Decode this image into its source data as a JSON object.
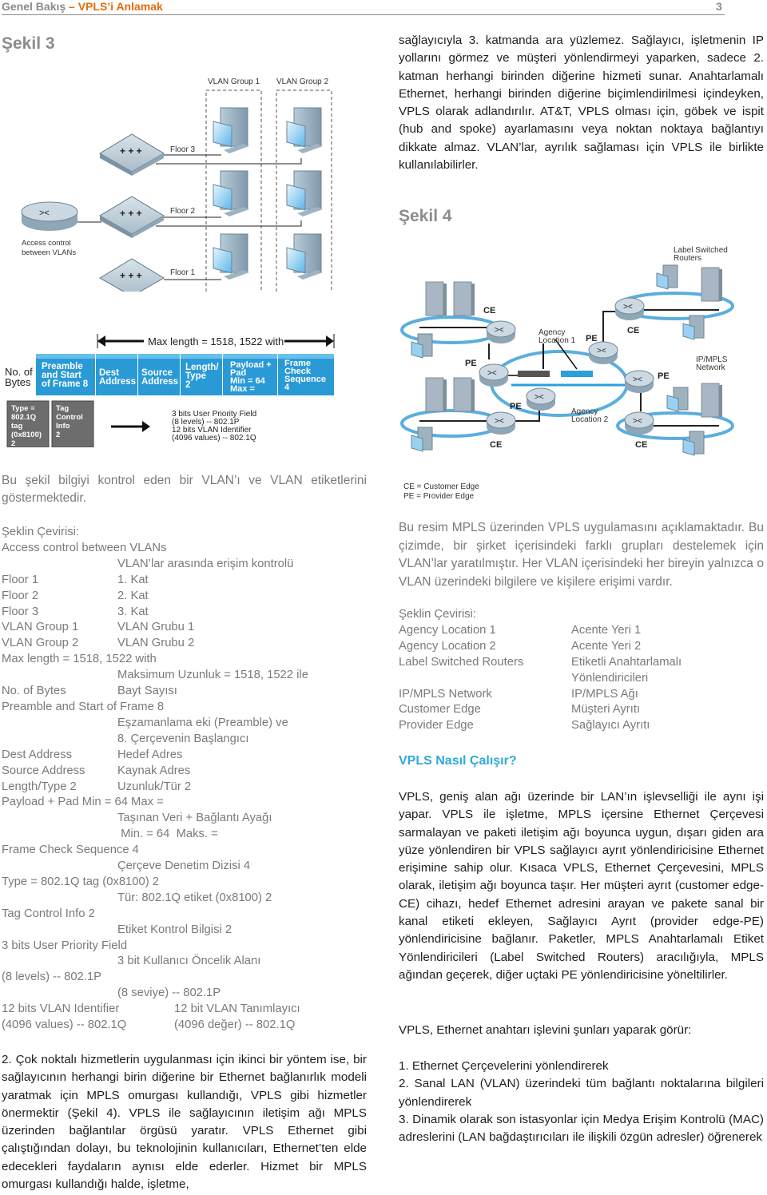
{
  "header": {
    "title_gray": "Genel Bakış ",
    "title_accent": "– VPLS’i Anlamak",
    "page_number": "3"
  },
  "colors": {
    "accent_orange": "#e36c0a",
    "section_blue": "#31a8d8",
    "frame_blue": "#2a9ad6",
    "tag_gray": "#6d6d6d"
  },
  "figure3": {
    "title": "Şekil 3",
    "vlan_groups": [
      "VLAN Group 1",
      "VLAN Group 2"
    ],
    "floors": [
      "Floor 3",
      "Floor 2",
      "Floor 1"
    ],
    "router_label_1": "Access control",
    "router_label_2": "between VLANs"
  },
  "frame_diagram": {
    "max_length": "Max length = 1518, 1522 with",
    "bytes_label_1": "No. of",
    "bytes_label_2": "Bytes",
    "cells": [
      [
        "Preamble",
        "and Start",
        "of Frame 8"
      ],
      [
        "Dest",
        "Address"
      ],
      [
        "Source",
        "Address"
      ],
      [
        "Length/",
        "Type",
        "2"
      ],
      [
        "Payload +",
        "Pad",
        "Min = 64",
        "Max ="
      ],
      [
        "Frame",
        "Check",
        "Sequence",
        "4"
      ]
    ],
    "tag_cells": [
      [
        "Type =",
        "802.1Q",
        "tag",
        "(0x8100)",
        "2"
      ],
      [
        "Tag",
        "Control",
        "Info",
        "2"
      ]
    ],
    "tag_details": [
      "3 bits User Priority Field",
      "(8 levels) -- 802.1P",
      "12 bits VLAN Identifier",
      "(4096 values) -- 802.1Q"
    ]
  },
  "figure3_caption": "Bu şekil bilgiyi kontrol eden bir VLAN’ı ve VLAN etiketlerini göstermektedir.",
  "translation_left": {
    "title": "Şeklin Çevirisi:",
    "entries": [
      {
        "en": "Access control between VLANs",
        "tr": "VLAN’lar arasında erişim kontrolü",
        "layout": "stacked"
      },
      {
        "en": "Floor 1",
        "tr": "1. Kat",
        "layout": "inline"
      },
      {
        "en": "Floor 2",
        "tr": "2. Kat",
        "layout": "inline"
      },
      {
        "en": "Floor 3",
        "tr": "3. Kat",
        "layout": "inline"
      },
      {
        "en": "VLAN Group 1",
        "tr": "VLAN Grubu 1",
        "layout": "inline"
      },
      {
        "en": "VLAN Group 2",
        "tr": "VLAN Grubu 2",
        "layout": "inline"
      },
      {
        "en": "Max length = 1518, 1522 with",
        "tr": "Maksimum Uzunluk = 1518, 1522 ile",
        "layout": "stacked"
      },
      {
        "en": "No. of Bytes",
        "tr": "Bayt Sayısı",
        "layout": "inline"
      },
      {
        "en": "Preamble and Start of Frame 8",
        "tr": "Eşzamanlama eki (Preamble) ve",
        "tr2": "8. Çerçevenin Başlangıcı",
        "layout": "stacked"
      },
      {
        "en": "Dest Address",
        "tr": "Hedef Adres",
        "layout": "inline"
      },
      {
        "en": "Source Address",
        "tr": "Kaynak Adres",
        "layout": "inline"
      },
      {
        "en": "Length/Type 2",
        "tr": "Uzunluk/Tür 2",
        "layout": "inline"
      },
      {
        "en": "Payload + Pad Min = 64 Max =",
        "tr": "Taşınan Veri + Bağlantı Ayağı",
        "tr2": " Min. = 64  Maks. =",
        "layout": "stacked"
      },
      {
        "en": "Frame Check Sequence 4",
        "tr": "Çerçeve Denetim Dizisi 4",
        "layout": "stacked"
      },
      {
        "en": "Type = 802.1Q tag (0x8100) 2",
        "tr": "Tür: 802.1Q etiket (0x8100) 2",
        "layout": "stacked"
      },
      {
        "en": "Tag Control Info 2",
        "tr": "Etiket Kontrol Bilgisi 2",
        "layout": "stacked"
      },
      {
        "en": "3 bits User Priority Field",
        "tr": "3 bit Kullanıcı Öncelik Alanı",
        "layout": "stacked"
      },
      {
        "en": "(8 levels) -- 802.1P",
        "tr": "(8 seviye) -- 802.1P",
        "layout": "stacked"
      },
      {
        "en": "12 bits VLAN Identifier",
        "tr": "12 bit VLAN Tanımlayıcı",
        "layout": "wide"
      },
      {
        "en": "(4096 values) -- 802.1Q",
        "tr": "(4096 değer) -- 802.1Q",
        "layout": "wide"
      }
    ]
  },
  "left_paragraph": "2. Çok noktalı hizmetlerin uygulanması için ikinci bir yöntem ise, bir sağlayıcının herhangi birin diğerine bir Ethernet bağlanırlık modeli yaratmak için MPLS omurgası kullandığı, VPLS gibi hizmetler önermektir (Şekil 4). VPLS ile sağlayıcının iletişim ağı MPLS üzerinden bağlantılar örgüsü yaratır. VPLS Ethernet gibi çalıştığından dolayı, bu teknolojinin kullanıcıları, Ethernet’ten elde edecekleri faydaların aynısı elde ederler. Hizmet bir MPLS omurgası kullandığı halde, işletme,",
  "right_intro_paragraph": "sağlayıcıyla 3. katmanda ara yüzlemez. Sağlayıcı, işletmenin IP yollarını görmez ve müşteri yönlendirmeyi yaparken, sadece 2. katman herhangi birinden diğerine hizmeti sunar. Anahtarlamalı Ethernet, herhangi birinden diğerine biçimlendirilmesi içindeyken, VPLS olarak adlandırılır. AT&T, VPLS olması için, göbek ve ispit (hub and spoke) ayarlamasını veya noktan noktaya bağlantıyı dikkate almaz. VLAN’lar, ayrılık sağlaması için VPLS ile birlikte kullanılabilirler.",
  "figure4": {
    "title": "Şekil 4",
    "label_switched_1": "Label Switched",
    "label_switched_2": "Routers",
    "ce": "CE",
    "pe": "PE",
    "agency1_1": "Agency",
    "agency1_2": "Location 1",
    "agency2_1": "Agency",
    "agency2_2": "Location 2",
    "network_1": "IP/MPLS",
    "network_2": "Network",
    "legend": [
      "CE = Customer Edge",
      "PE = Provider Edge"
    ]
  },
  "figure4_caption": "Bu resim MPLS üzerinden VPLS uygulamasını açıklamaktadır. Bu çizimde, bir şirket içerisindeki farklı grupları destelemek için VLAN’lar yaratılmıştır. Her VLAN içerisindeki her bireyin yalnızca o VLAN üzerindeki bilgilere ve kişilere erişimi vardır.",
  "translation_right": {
    "title": "Şeklin Çevirisi:",
    "entries": [
      {
        "en": "Agency Location 1",
        "tr": "Acente Yeri 1"
      },
      {
        "en": "Agency Location 2",
        "tr": "Acente Yeri 2"
      },
      {
        "en": "Label Switched Routers",
        "tr": "Etiketli Anahtarlamalı",
        "tr2": "Yönlendiricileri"
      },
      {
        "en": "IP/MPLS Network",
        "tr": "IP/MPLS Ağı"
      },
      {
        "en": "Customer Edge",
        "tr": "Müşteri Ayrıtı"
      },
      {
        "en": "Provider Edge",
        "tr": "Sağlayıcı Ayrıtı"
      }
    ]
  },
  "section": {
    "title": "VPLS Nasıl Çalışır?",
    "paragraph": "VPLS, geniş alan ağı üzerinde bir LAN’ın işlevselliği ile aynı işi yapar. VPLS ile işletme, MPLS içersine Ethernet Çerçevesi sarmalayan ve paketi iletişim ağı boyunca uygun, dışarı giden ara yüze yönlendiren bir VPLS sağlayıcı ayrıt yönlendiricisine Ethernet erişimine sahip olur. Kısaca VPLS, Ethernet Çerçevesini, MPLS olarak, iletişim ağı boyunca taşır. Her müşteri ayrıt (customer edge-CE) cihazı, hedef Ethernet adresini arayan ve pakete sanal bir kanal etiketi ekleyen, Sağlayıcı Ayrıt (provider edge-PE) yönlendiricisine bağlanır. Paketler, MPLS Anahtarlamalı Etiket Yönlendiricileri (Label Switched Routers) aracılığıyla, MPLS ağından geçerek, diğer uçtaki PE yönlendiricisine yöneltilirler.",
    "list_intro": "VPLS, Ethernet anahtarı işlevini şunları yaparak görür:",
    "list": [
      "1. Ethernet Çerçevelerini yönlendirerek",
      "2. Sanal LAN (VLAN) üzerindeki tüm bağlantı noktalarına bilgileri yönlendirerek",
      "3. Dinamik olarak son istasyonlar için Medya Erişim Kontrolü (MAC) adreslerini (LAN bağdaştırıcıları ile ilişkili özgün adresler) öğrenerek"
    ]
  }
}
